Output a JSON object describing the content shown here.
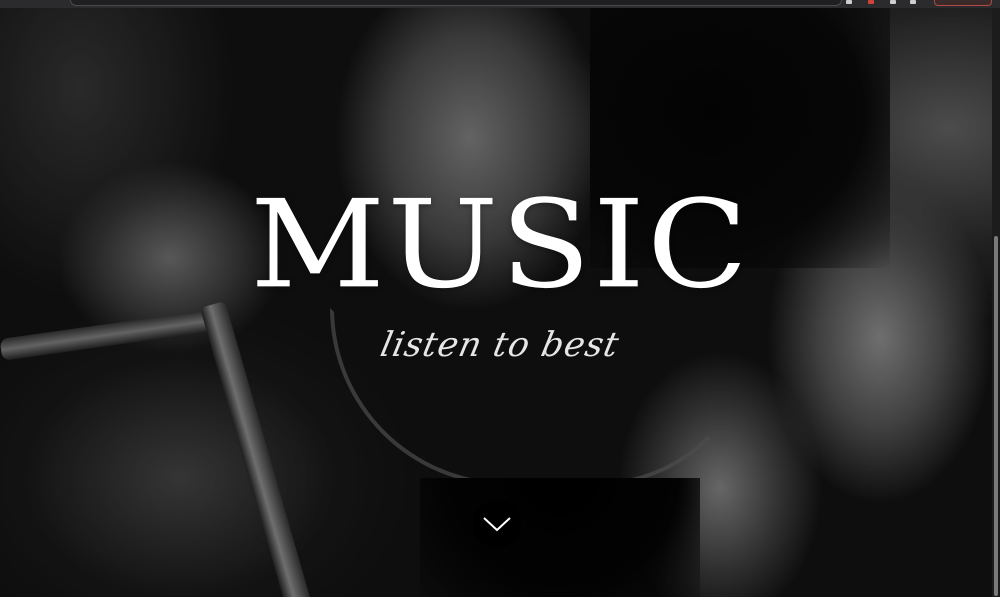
{
  "hero": {
    "title": "MUSIC",
    "subtitle": "listen to best"
  },
  "scroll_button": {
    "icon": "chevron-down-icon"
  },
  "colors": {
    "title": "#ffffff",
    "subtitle": "#e6e6e6",
    "scroll_button_bg": "#000000",
    "browser_bar": "#2b2b2e"
  }
}
